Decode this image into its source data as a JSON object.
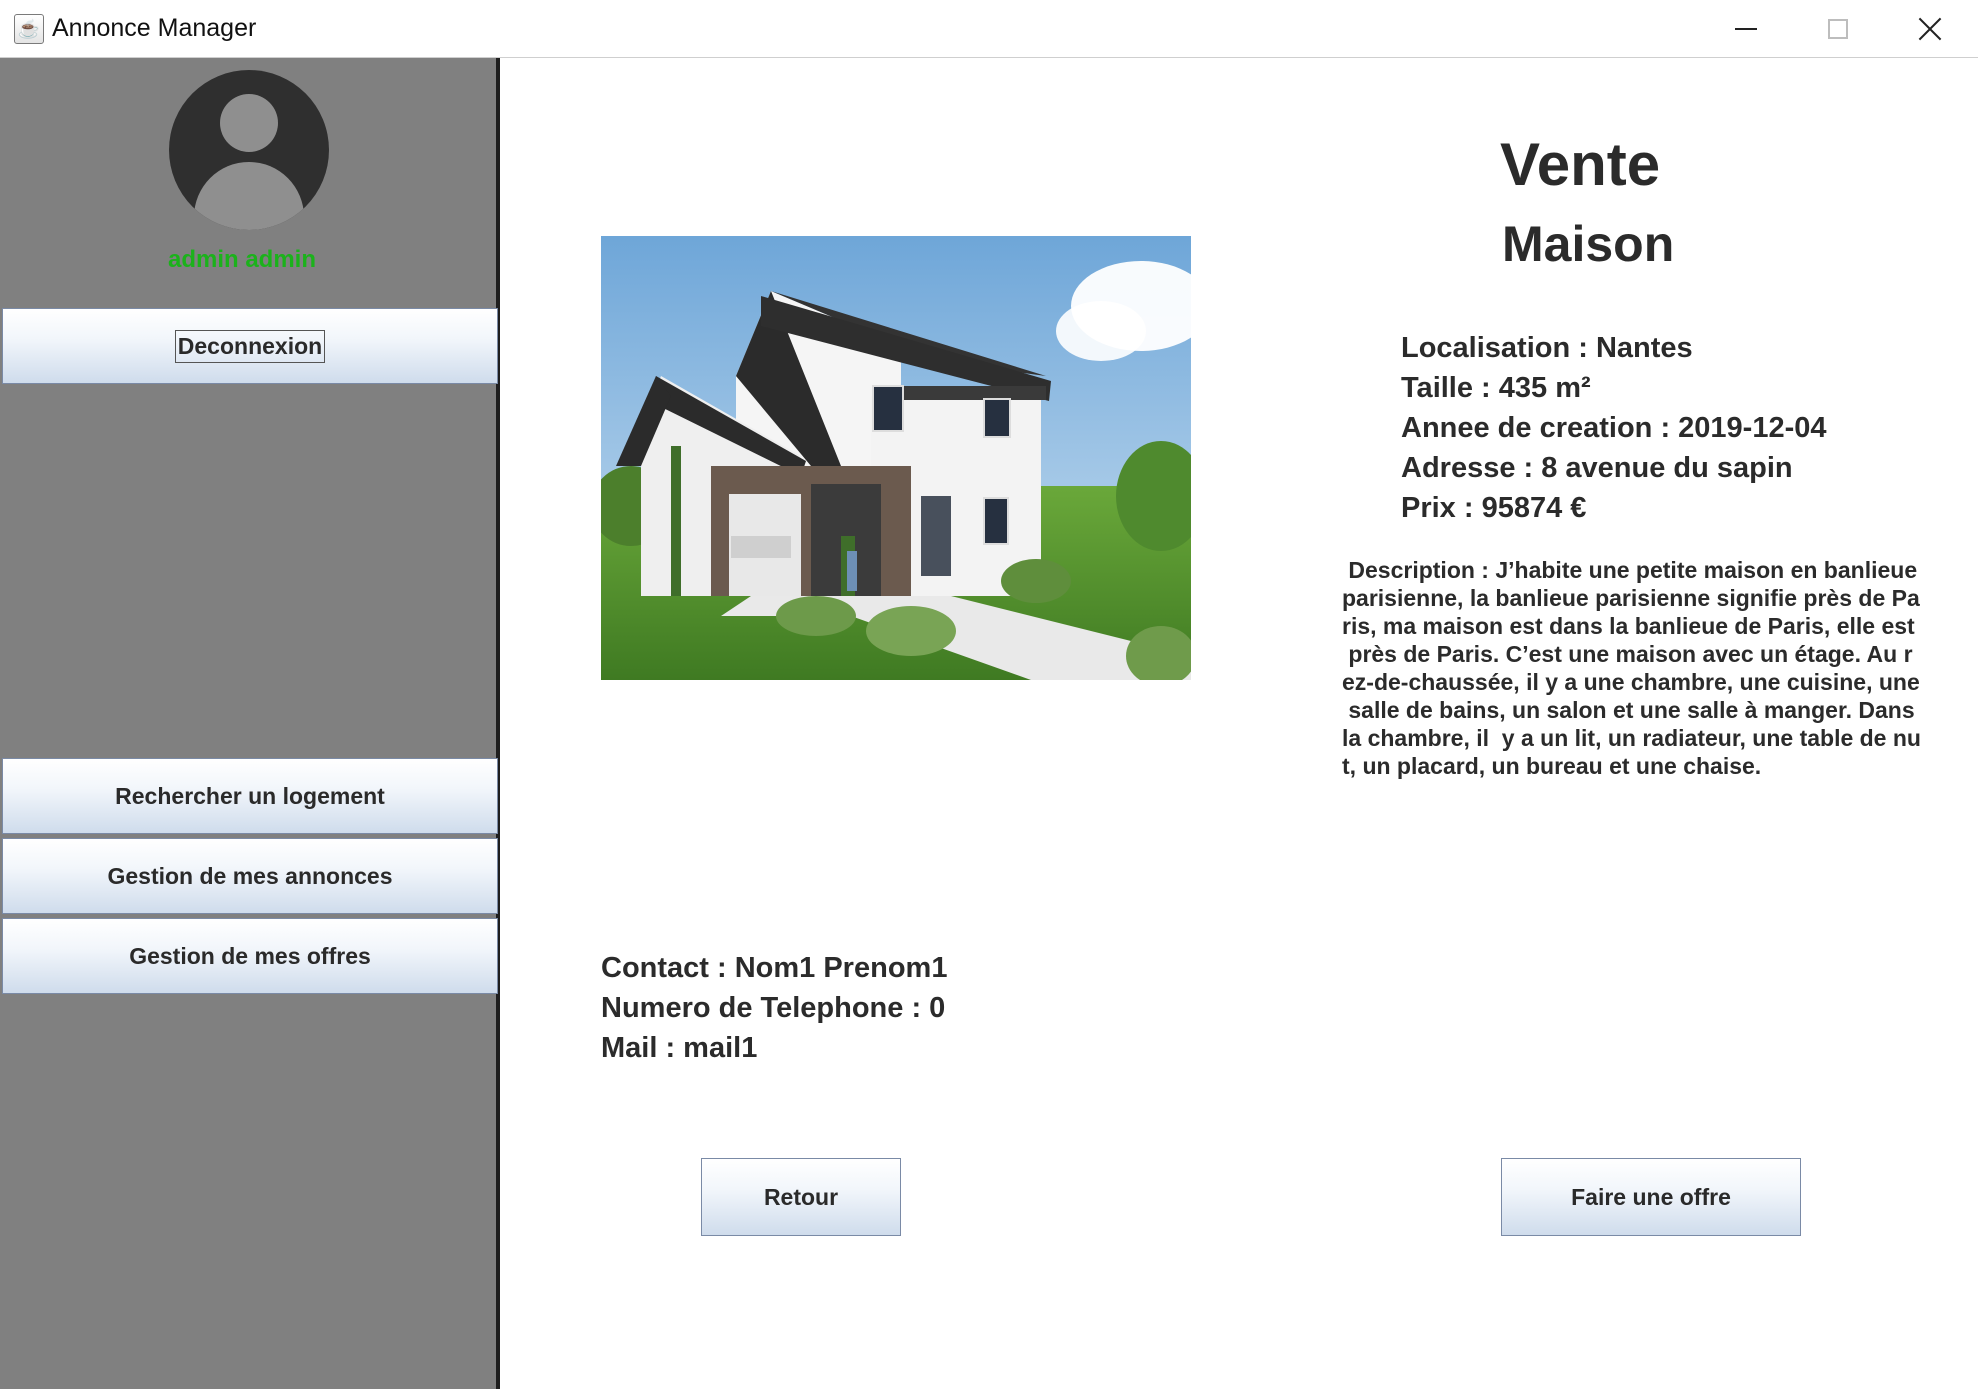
{
  "window": {
    "title": "Annonce Manager",
    "icon": "java-cup-icon"
  },
  "sidebar": {
    "username": "admin admin",
    "logout_label": "Deconnexion",
    "nav": [
      {
        "label": "Rechercher un logement"
      },
      {
        "label": "Gestion de mes annonces"
      },
      {
        "label": "Gestion de mes offres"
      }
    ]
  },
  "listing": {
    "transaction_type": "Vente",
    "property_type": "Maison",
    "details": [
      "Localisation : Nantes",
      "Taille : 435 m²",
      "Annee de creation : 2019-12-04",
      "Adresse : 8 avenue du sapin",
      "Prix : 95874 €"
    ],
    "description": " Description : J’habite une petite maison en banlieue\nparisienne, la banlieue parisienne signifie près de Pa\nris, ma maison est dans la banlieue de Paris, elle est\n près de Paris. C’est une maison avec un étage. Au r\nez-de-chaussée, il y a une chambre, une cuisine, une\n salle de bains, un salon et une salle à manger. Dans\nla chambre, il  y a un lit, un radiateur, une table de nu\nt, un placard, un bureau et une chaise."
  },
  "contact": {
    "lines": [
      "Contact : Nom1 Prenom1",
      "Numero de Telephone : 0",
      "Mail : mail1"
    ]
  },
  "actions": {
    "back_label": "Retour",
    "offer_label": "Faire une offre"
  },
  "colors": {
    "sidebar_bg": "#808080",
    "username": "#1bb21b",
    "button_gradient_end": "#cfdcec"
  }
}
